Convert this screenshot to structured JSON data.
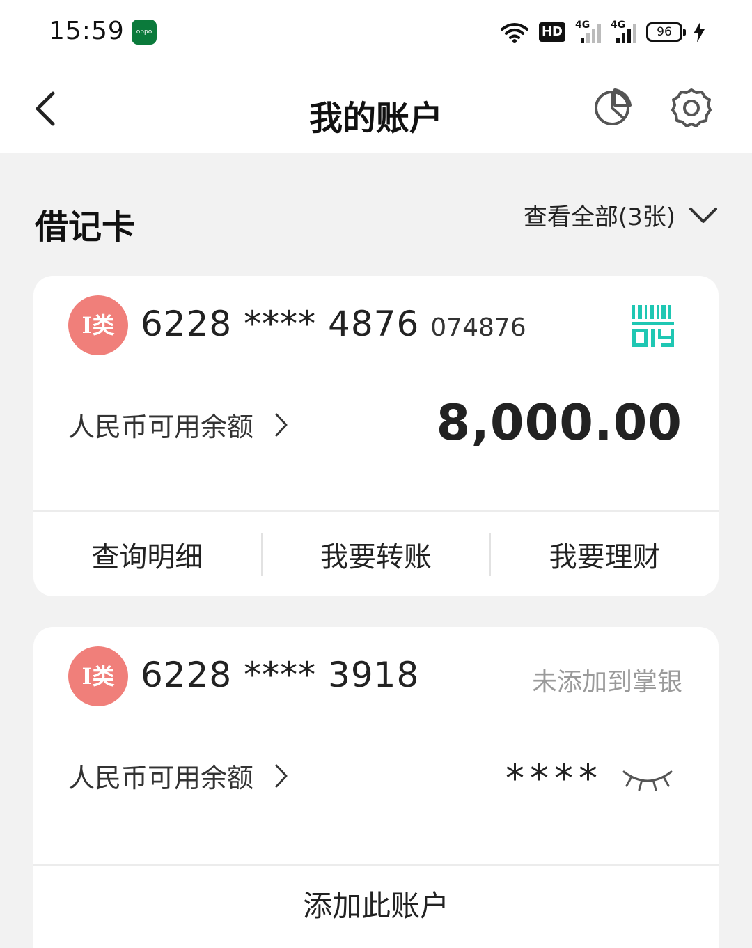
{
  "status_bar": {
    "time": "15:59",
    "app_badge": "oppo",
    "hd_label": "HD",
    "net1_label": "4G",
    "net2_label": "4G",
    "battery": "96"
  },
  "nav": {
    "title": "我的账户"
  },
  "section": {
    "title": "借记卡",
    "view_all": "查看全部(3张)"
  },
  "cards": [
    {
      "type_badge": "I类",
      "number": "6228 **** 4876",
      "suffix": "074876",
      "balance_label": "人民币可用余额",
      "balance": "8,000.00",
      "actions": [
        "查询明细",
        "我要转账",
        "我要理财"
      ]
    },
    {
      "type_badge": "I类",
      "number": "6228 **** 3918",
      "status": "未添加到掌银",
      "balance_label": "人民币可用余额",
      "balance_masked": "****",
      "add_label": "添加此账户"
    }
  ],
  "colors": {
    "badge_red": "#f07f7a",
    "qr_teal": "#1fc7b3",
    "page_bg": "#f2f2f2"
  },
  "icons": {
    "back": "chevron-left-icon",
    "chart": "pie-chart-icon",
    "settings": "gear-icon",
    "qr": "qr-code-icon",
    "hide": "eye-closed-icon"
  }
}
